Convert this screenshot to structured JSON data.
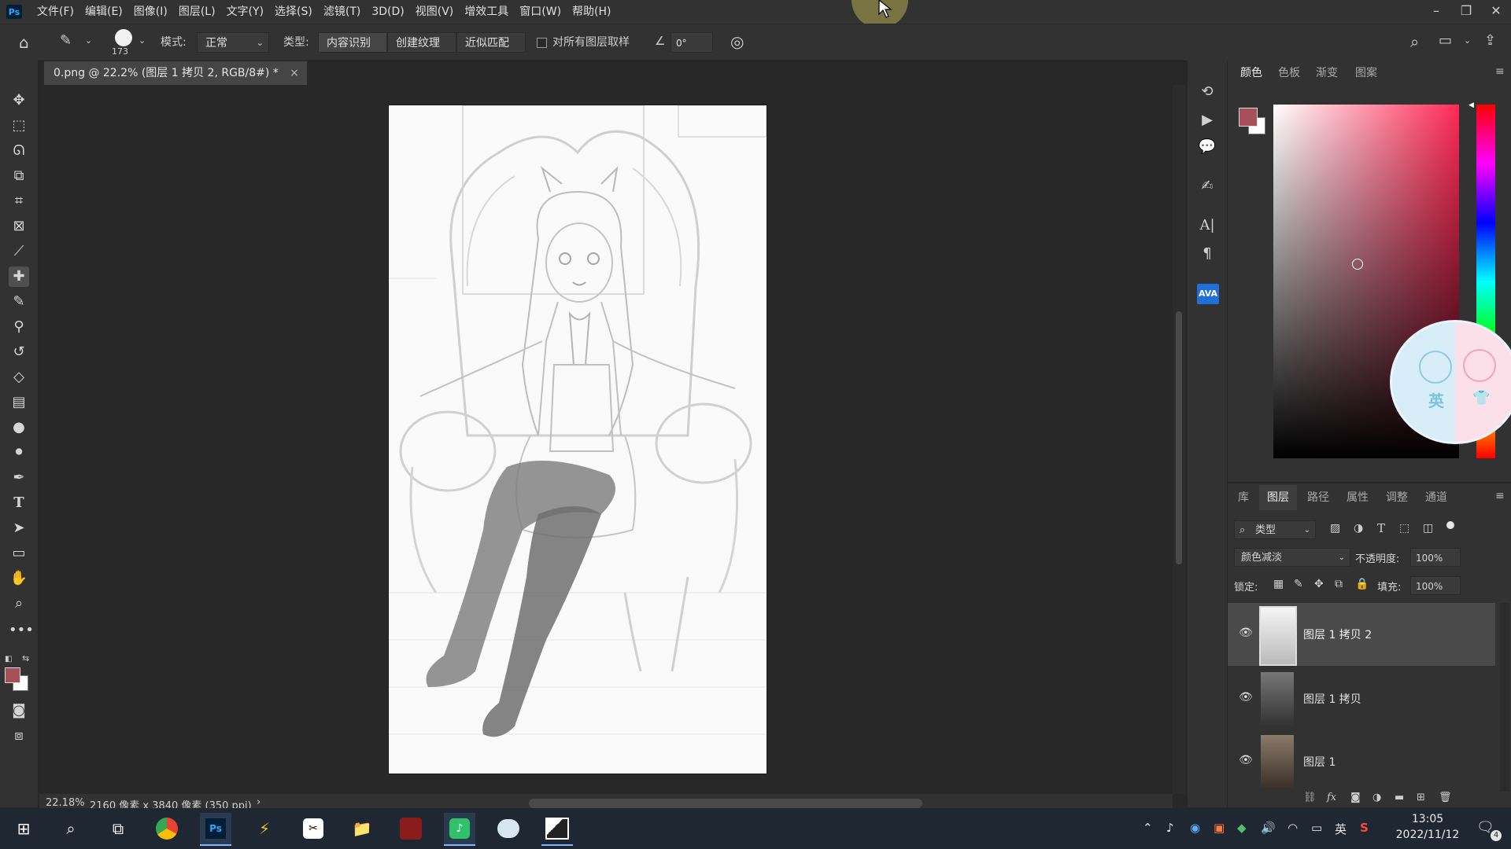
{
  "menu": {
    "app_logo": "Ps",
    "items": [
      "文件(F)",
      "编辑(E)",
      "图像(I)",
      "图层(L)",
      "文字(Y)",
      "选择(S)",
      "滤镜(T)",
      "3D(D)",
      "视图(V)",
      "增效工具",
      "窗口(W)",
      "帮助(H)"
    ]
  },
  "window_controls": {
    "minimize": "–",
    "restore": "❐",
    "close": "✕"
  },
  "options": {
    "brush_size": "173",
    "mode_label": "模式:",
    "mode_value": "正常",
    "type_label": "类型:",
    "type_buttons": [
      "内容识别",
      "创建纹理",
      "近似匹配"
    ],
    "sample_all_label": "对所有图层取样",
    "angle_value": "0°"
  },
  "document": {
    "tab_title": "0.png @ 22.2% (图层 1 拷贝 2, RGB/8#) *",
    "close": "×"
  },
  "status": {
    "zoom": "22.18%",
    "info": "2160 像素 x 3840 像素 (350 ppi)",
    "arrow": "›"
  },
  "mid_panel": {
    "ava_label": "AVA"
  },
  "color_panel": {
    "tabs": [
      "颜色",
      "色板",
      "渐变",
      "图案"
    ],
    "active_tab": 0,
    "foreground": "#a8505a",
    "background": "#ffffff",
    "hue_color": "#ff2a55"
  },
  "layers_panel": {
    "tabs": [
      "库",
      "图层",
      "路径",
      "属性",
      "调整",
      "通道"
    ],
    "active_tab": 1,
    "filter_kind": "类型",
    "blend_mode": "颜色减淡",
    "opacity_label": "不透明度:",
    "opacity_value": "100%",
    "lock_label": "锁定:",
    "fill_label": "填充:",
    "fill_value": "100%",
    "layers": [
      {
        "name": "图层 1 拷贝 2",
        "selected": true
      },
      {
        "name": "图层 1 拷贝",
        "selected": false
      },
      {
        "name": "图层 1",
        "selected": false
      }
    ]
  },
  "ime_overlay": {
    "char": "英"
  },
  "taskbar": {
    "clock_time": "13:05",
    "clock_date": "2022/11/12",
    "ime": "英",
    "notification_count": "4"
  }
}
